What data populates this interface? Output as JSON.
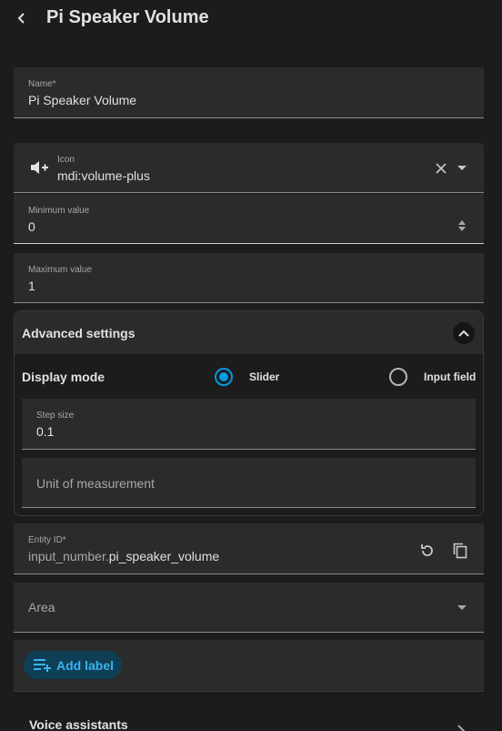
{
  "header": {
    "title": "Pi Speaker Volume"
  },
  "name_field": {
    "label": "Name*",
    "value": "Pi Speaker Volume"
  },
  "icon_field": {
    "label": "Icon",
    "value": "mdi:volume-plus"
  },
  "min_field": {
    "label": "Minimum value",
    "value": "0"
  },
  "max_field": {
    "label": "Maximum value",
    "value": "1"
  },
  "advanced": {
    "title": "Advanced settings",
    "display_mode_label": "Display mode",
    "options": [
      {
        "label": "Slider",
        "selected": true
      },
      {
        "label": "Input field",
        "selected": false
      }
    ],
    "step_field": {
      "label": "Step size",
      "value": "0.1"
    },
    "unit_field": {
      "placeholder": "Unit of measurement"
    }
  },
  "entity_field": {
    "label": "Entity ID*",
    "prefix": "input_number.",
    "suffix": "pi_speaker_volume"
  },
  "area_field": {
    "placeholder": "Area"
  },
  "add_label_button": "Add label",
  "voice_assistants": "Voice assistants",
  "colors": {
    "accent": "#039be5",
    "chip_bg": "#0f3f57",
    "chip_text": "#3ab3f0",
    "background": "#1c1c1c",
    "field_bg": "#2b2b2b"
  }
}
